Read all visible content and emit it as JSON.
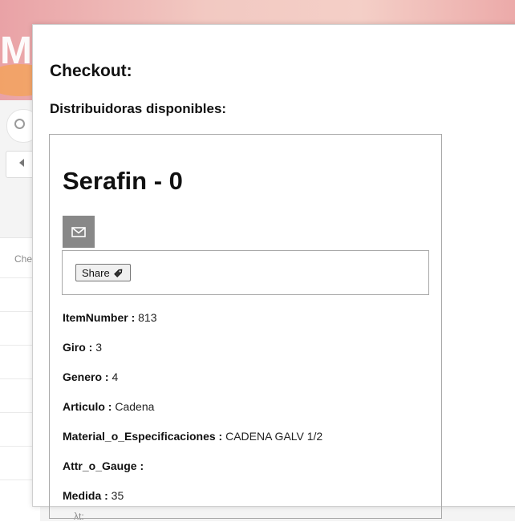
{
  "background": {
    "hero_letter": "M",
    "table_header_partial": "Che",
    "footer_partial": "λt:"
  },
  "modal": {
    "title": "Checkout:",
    "subtitle": "Distribuidoras disponibles:"
  },
  "card": {
    "title": "Serafin - 0",
    "email_icon": "mail-icon",
    "share_label": "Share",
    "share_icon": "tag-icon",
    "fields": [
      {
        "key": "ItemNumber :",
        "value": "813"
      },
      {
        "key": "Giro :",
        "value": "3"
      },
      {
        "key": "Genero :",
        "value": "4"
      },
      {
        "key": "Articulo :",
        "value": "Cadena"
      },
      {
        "key": "Material_o_Especificaciones :",
        "value": "CADENA GALV 1/2"
      },
      {
        "key": "Attr_o_Gauge :",
        "value": ""
      },
      {
        "key": "Medida :",
        "value": "35"
      }
    ]
  },
  "colors": {
    "email_button_bg": "#888888",
    "hero_pink": "#e9a2a6"
  }
}
